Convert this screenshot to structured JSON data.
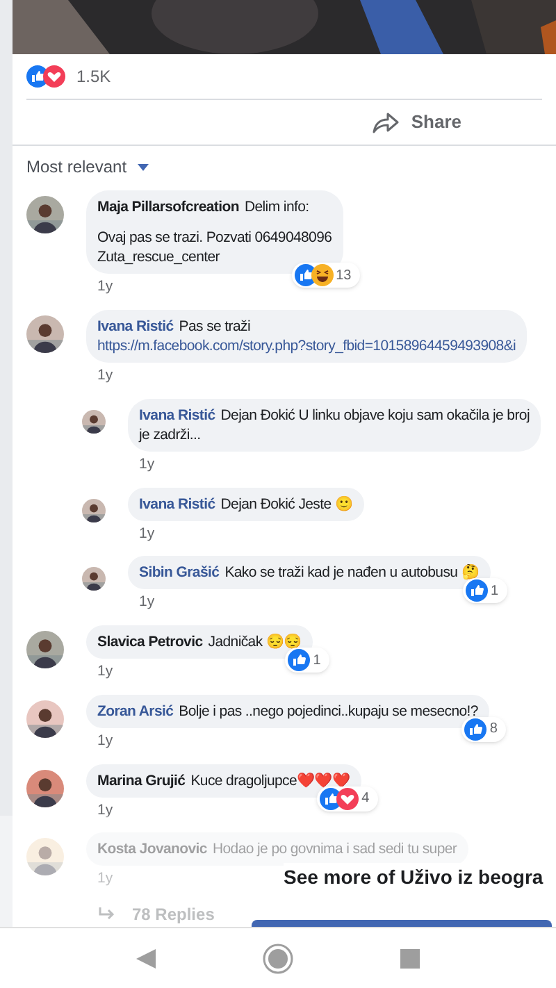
{
  "post": {
    "reactions": [
      {
        "kind": "like"
      },
      {
        "kind": "love"
      }
    ],
    "reaction_count": "1.5K",
    "share_label": "Share"
  },
  "sort": {
    "label": "Most relevant"
  },
  "comments": [
    {
      "name": "Maja Pillarsofcreation",
      "name_link": false,
      "lines": [
        "Delim info:"
      ],
      "extra_lines": [
        "Ovaj pas se trazi. Pozvati 0649048096",
        "Zuta_rescue_center"
      ],
      "time": "1y",
      "reactions": [
        {
          "kind": "like"
        },
        {
          "kind": "haha"
        }
      ],
      "count": "13"
    },
    {
      "name": "Ivana Ristić",
      "name_link": true,
      "lines": [
        "Pas se traži"
      ],
      "link": "https://m.facebook.com/story.php?story_fbid=10158964459493908&i",
      "time": "1y",
      "replies": [
        {
          "name": "Ivana Ristić",
          "name_link": true,
          "lines": [
            "Dejan Đokić U linku objave koju sam okačila je broj",
            "je zadrži..."
          ],
          "time": "1y"
        },
        {
          "name": "Ivana Ristić",
          "name_link": true,
          "lines": [
            "Dejan Đokić Jeste 🙂"
          ],
          "time": "1y"
        },
        {
          "name": "Sibin Grašić",
          "name_link": true,
          "lines": [
            "Kako se traži kad je nađen u autobusu 🤔"
          ],
          "time": "1y",
          "reactions": [
            {
              "kind": "like"
            }
          ],
          "count": "1"
        }
      ]
    },
    {
      "name": "Slavica Petrovic",
      "name_link": false,
      "lines": [
        "Jadničak 😔😔"
      ],
      "time": "1y",
      "reactions": [
        {
          "kind": "like"
        }
      ],
      "count": "1"
    },
    {
      "name": "Zoran Arsić",
      "name_link": true,
      "lines": [
        "Bolje i pas ..nego pojedinci..kupaju se mesecno!?"
      ],
      "time": "1y",
      "reactions": [
        {
          "kind": "like"
        }
      ],
      "count": "8"
    },
    {
      "name": "Marina Grujić",
      "name_link": false,
      "lines": [
        "Kuce dragoljupce❤️❤️❤️"
      ],
      "time": "1y",
      "reactions": [
        {
          "kind": "like"
        },
        {
          "kind": "love"
        }
      ],
      "count": "4"
    },
    {
      "name": "Kosta Jovanovic",
      "name_link": false,
      "lines": [
        "Hodao je po govnima i sad sedi tu super"
      ],
      "time": "1y",
      "more_replies": "78 Replies"
    }
  ],
  "overlay": {
    "title": "See more of Uživo iz beogra"
  }
}
